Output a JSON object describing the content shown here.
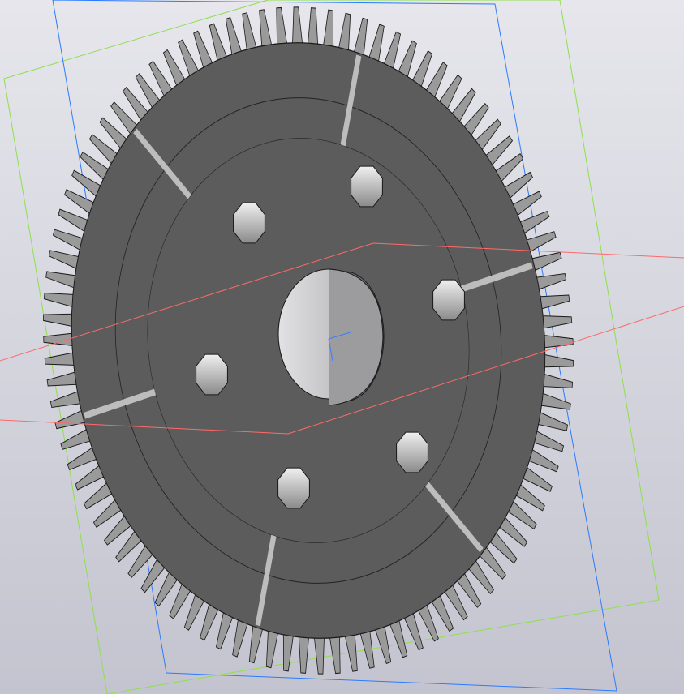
{
  "viewport": {
    "background_top": "#e6e6ec",
    "background_bottom": "#c4c4d0",
    "plane_colors": {
      "front": "#2a7bff",
      "top": "#8ee04a",
      "right": "#ff6a6a"
    }
  },
  "model": {
    "name_icon": "gear-model",
    "body_color": "#5c5c5c",
    "tooth_color": "#9a9a9a",
    "edge_color": "#1a1a1a",
    "bore_color": "#cfcfd2",
    "tooth_count": 96,
    "hole_count": 6
  }
}
